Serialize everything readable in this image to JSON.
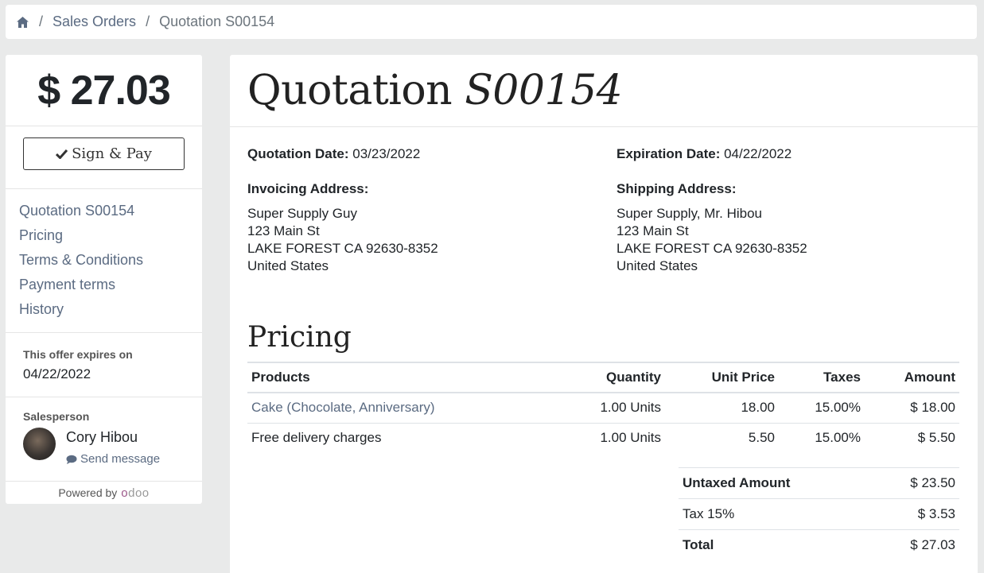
{
  "breadcrumb": {
    "home_icon": "home-icon",
    "items": [
      "Sales Orders",
      "Quotation S00154"
    ]
  },
  "sidebar": {
    "total": "$ 27.03",
    "sign_pay_label": "Sign & Pay",
    "nav": [
      "Quotation S00154",
      "Pricing",
      "Terms & Conditions",
      "Payment terms",
      "History"
    ],
    "expires_label": "This offer expires on",
    "expires_date": "04/22/2022",
    "salesperson_label": "Salesperson",
    "salesperson_name": "Cory Hibou",
    "send_message": "Send message",
    "powered_by": "Powered by",
    "logo_text": "odoo"
  },
  "quote": {
    "title_prefix": "Quotation",
    "title_number": "S00154",
    "date_label": "Quotation Date:",
    "date_value": "03/23/2022",
    "expiration_label": "Expiration Date:",
    "expiration_value": "04/22/2022",
    "invoicing": {
      "label": "Invoicing Address:",
      "lines": [
        "Super Supply Guy",
        "123 Main St",
        "LAKE FOREST CA 92630-8352",
        "United States"
      ]
    },
    "shipping": {
      "label": "Shipping Address:",
      "lines": [
        "Super Supply, Mr. Hibou",
        "123 Main St",
        "LAKE FOREST CA 92630-8352",
        "United States"
      ]
    }
  },
  "pricing": {
    "title": "Pricing",
    "columns": [
      "Products",
      "Quantity",
      "Unit Price",
      "Taxes",
      "Amount"
    ],
    "rows": [
      {
        "product": "Cake (Chocolate, Anniversary)",
        "quantity": "1.00 Units",
        "unit_price": "18.00",
        "taxes": "15.00%",
        "amount": "$ 18.00"
      },
      {
        "product": "Free delivery charges",
        "quantity": "1.00 Units",
        "unit_price": "5.50",
        "taxes": "15.00%",
        "amount": "$ 5.50"
      }
    ],
    "totals": {
      "untaxed_label": "Untaxed Amount",
      "untaxed_value": "$ 23.50",
      "tax_label": "Tax 15%",
      "tax_value": "$ 3.53",
      "total_label": "Total",
      "total_value": "$ 27.03"
    }
  },
  "colors": {
    "link": "#5b6b82",
    "background": "#e9eaea"
  }
}
